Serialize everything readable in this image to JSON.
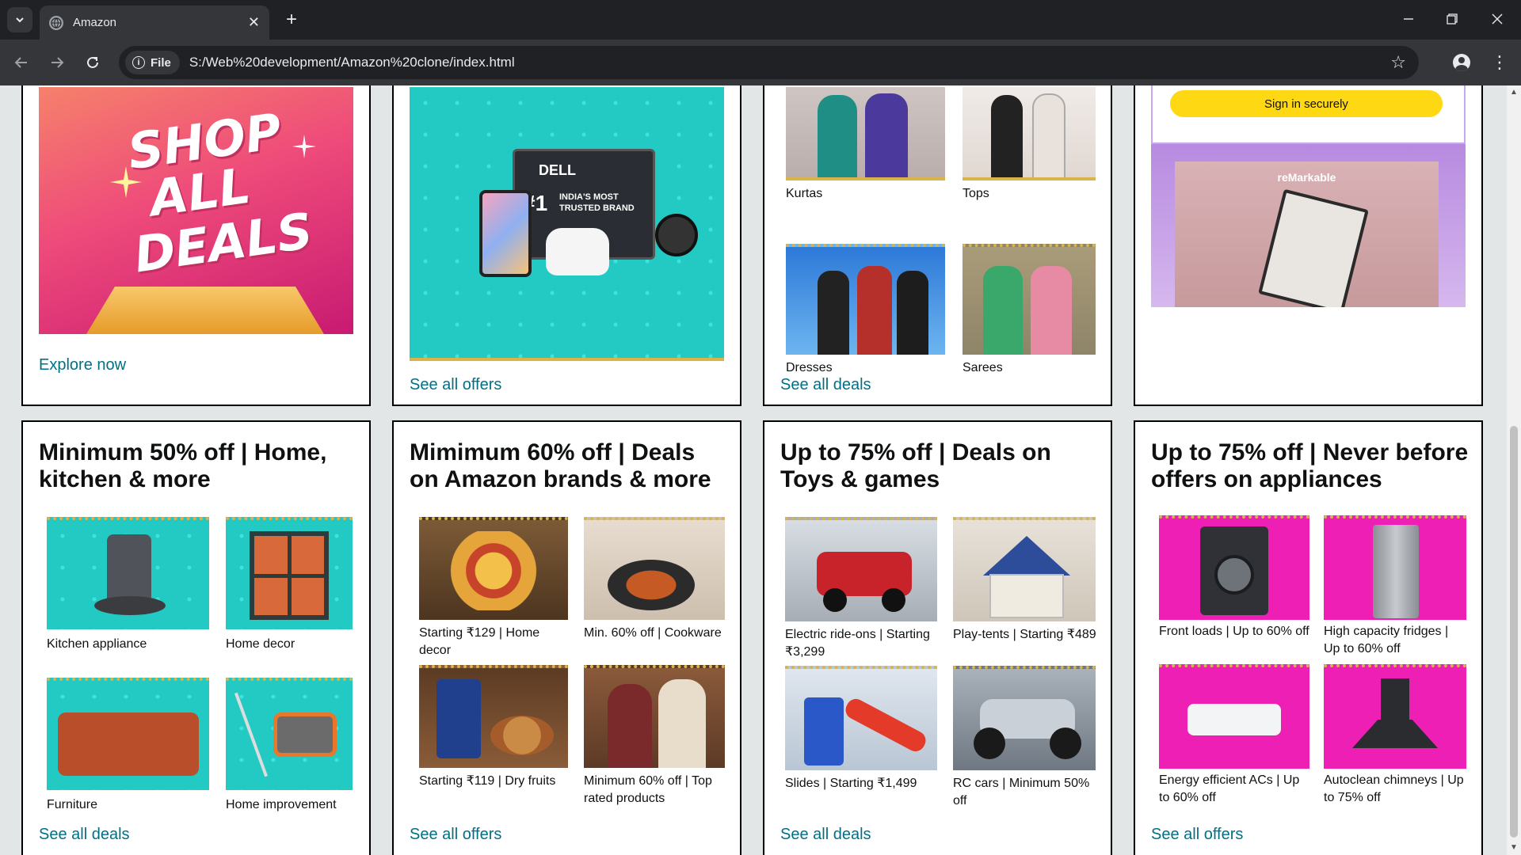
{
  "browser": {
    "tab_title": "Amazon",
    "site_chip": "File",
    "url": "S:/Web%20development/Amazon%20clone/index.html"
  },
  "top_row": {
    "card1": {
      "link": "Explore now",
      "image_text": [
        "SHOP",
        "ALL",
        "DEALS"
      ]
    },
    "card2": {
      "link": "See all offers",
      "image_text": {
        "brand": "DELL",
        "tag": "#1",
        "line1": "INDIA'S MOST",
        "line2": "TRUSTED BRAND"
      }
    },
    "card3": {
      "link": "See all deals",
      "items": [
        "Kurtas",
        "Tops",
        "Dresses",
        "Sarees"
      ]
    },
    "card4": {
      "button": "Sign in securely",
      "image_text": "reMarkable"
    }
  },
  "bottom_row": [
    {
      "title": "Minimum 50% off | Home, kitchen & more",
      "link": "See all deals",
      "items": [
        "Kitchen appliance",
        "Home decor",
        "Furniture",
        "Home improvement"
      ]
    },
    {
      "title": "Mimimum 60% off | Deals on Amazon brands & more",
      "link": "See all offers",
      "items": [
        "Starting ₹129 | Home decor",
        "Min. 60% off | Cookware",
        "Starting ₹119 | Dry fruits",
        "Minimum 60% off | Top rated products"
      ]
    },
    {
      "title": "Up to 75% off | Deals on Toys & games",
      "link": "See all deals",
      "items": [
        "Electric ride-ons | Starting ₹3,299",
        "Play-tents | Starting ₹489",
        "Slides | Starting ₹1,499",
        "RC cars | Minimum 50% off"
      ]
    },
    {
      "title": "Up to 75% off | Never before offers on appliances",
      "link": "See all offers",
      "items": [
        "Front loads | Up to 60% off",
        "High capacity fridges | Up to 60% off",
        "Energy efficient ACs | Up to 60% off",
        "Autoclean chimneys | Up to 75% off"
      ]
    }
  ],
  "colors": {
    "link": "#007185",
    "signin": "#ffd814",
    "teal": "#26cfc9",
    "pink": "#ee1fb5"
  }
}
